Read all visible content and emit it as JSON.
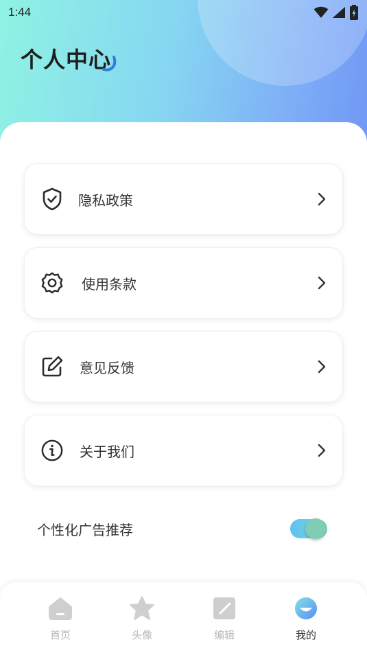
{
  "status_bar": {
    "time": "1:44"
  },
  "header": {
    "title": "个人中心"
  },
  "menu": {
    "items": [
      {
        "label": "隐私政策",
        "icon": "shield-check-icon"
      },
      {
        "label": "使用条款",
        "icon": "gear-icon"
      },
      {
        "label": "意见反馈",
        "icon": "edit-icon"
      },
      {
        "label": "关于我们",
        "icon": "info-icon"
      }
    ]
  },
  "settings": {
    "personalized_ads_label": "个性化广告推荐",
    "personalized_ads_enabled": true
  },
  "tab_bar": {
    "tabs": [
      {
        "label": "首页",
        "icon": "home-icon",
        "active": false
      },
      {
        "label": "头像",
        "icon": "star-icon",
        "active": false
      },
      {
        "label": "编辑",
        "icon": "edit-square-icon",
        "active": false
      },
      {
        "label": "我的",
        "icon": "profile-icon",
        "active": true
      }
    ]
  },
  "colors": {
    "header_gradient_start": "#8ff3e3",
    "header_gradient_end": "#6f96f5",
    "toggle_on": "#5ec1f5",
    "tab_inactive": "#b7b7b7"
  }
}
